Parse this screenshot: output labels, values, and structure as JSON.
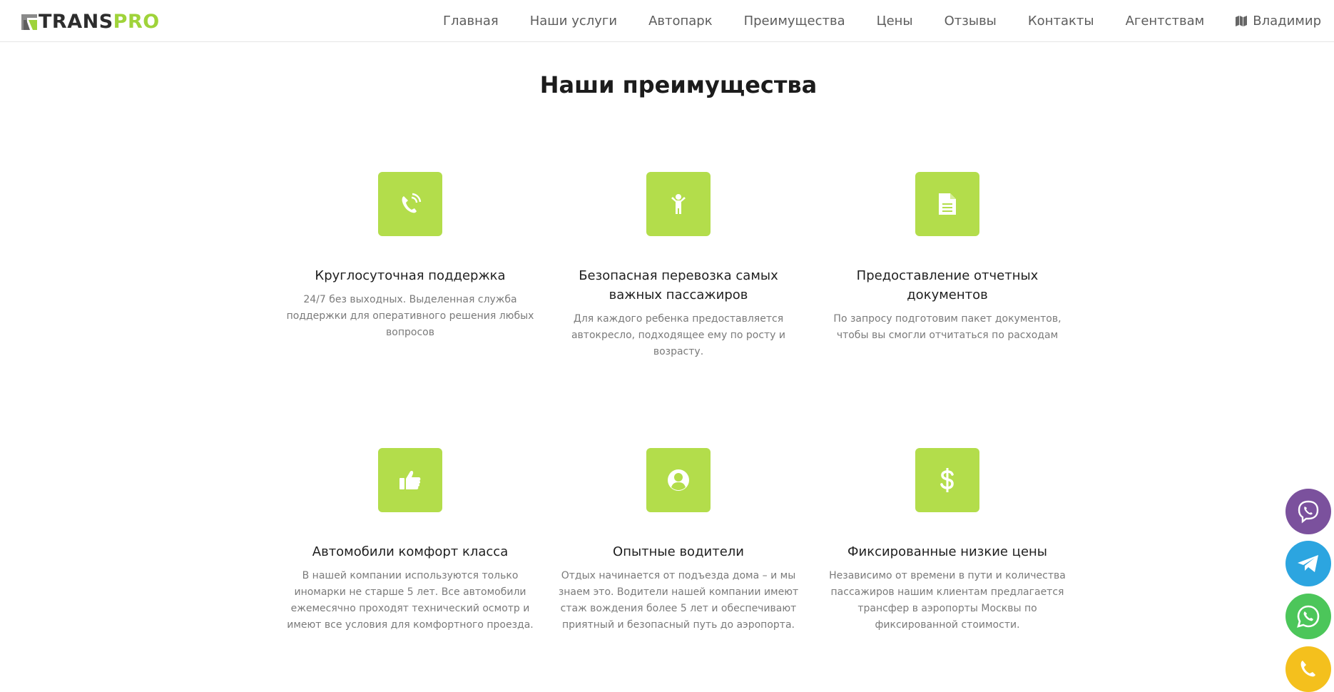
{
  "logo": {
    "part1": "TRANS",
    "part2": "PRO"
  },
  "nav": {
    "items": [
      "Главная",
      "Наши услуги",
      "Автопарк",
      "Преимущества",
      "Цены",
      "Отзывы",
      "Контакты",
      "Агентствам"
    ],
    "city": "Владимир"
  },
  "section": {
    "title": "Наши преимущества"
  },
  "advantages": [
    {
      "icon": "phone-icon",
      "title": "Круглосуточная поддержка",
      "text": "24/7 без выходных. Выделенная служба поддержки для оперативного решения любых вопросов"
    },
    {
      "icon": "child-icon",
      "title": "Безопасная перевозка самых важных пассажиров",
      "text": "Для каждого ребенка предоставляется автокресло, подходящее ему по росту и возрасту."
    },
    {
      "icon": "document-icon",
      "title": "Предоставление отчетных документов",
      "text": "По запросу подготовим пакет документов, чтобы вы смогли отчитаться по расходам"
    },
    {
      "icon": "thumbs-up-icon",
      "title": "Автомобили комфорт класса",
      "text": "В нашей компании используются только иномарки не старше 5 лет. Все автомобили ежемесячно проходят технический осмотр и имеют все условия для комфортного проезда."
    },
    {
      "icon": "user-circle-icon",
      "title": "Опытные водители",
      "text": "Отдых начинается от подъезда дома – и мы знаем это. Водители нашей компании имеют стаж вождения более 5 лет и обеспечивают приятный и безопасный путь до аэропорта."
    },
    {
      "icon": "dollar-icon",
      "title": "Фиксированные низкие цены",
      "text": "Независимо от времени в пути и количества пассажиров нашим клиентам предлагается трансфер в аэропорты Москвы по фиксированной стоимости."
    }
  ],
  "contacts": [
    {
      "icon": "viber-icon",
      "color": "#7b519d"
    },
    {
      "icon": "telegram-icon",
      "color": "#2ca5e0"
    },
    {
      "icon": "whatsapp-icon",
      "color": "#4cc65a"
    },
    {
      "icon": "phone-call-icon",
      "color": "#f4c01d"
    }
  ],
  "colors": {
    "accent": "#b3dd4b",
    "brand_green": "#9fd33a",
    "text_dark": "#1f1f1f",
    "text_muted": "#7a7a7a"
  }
}
